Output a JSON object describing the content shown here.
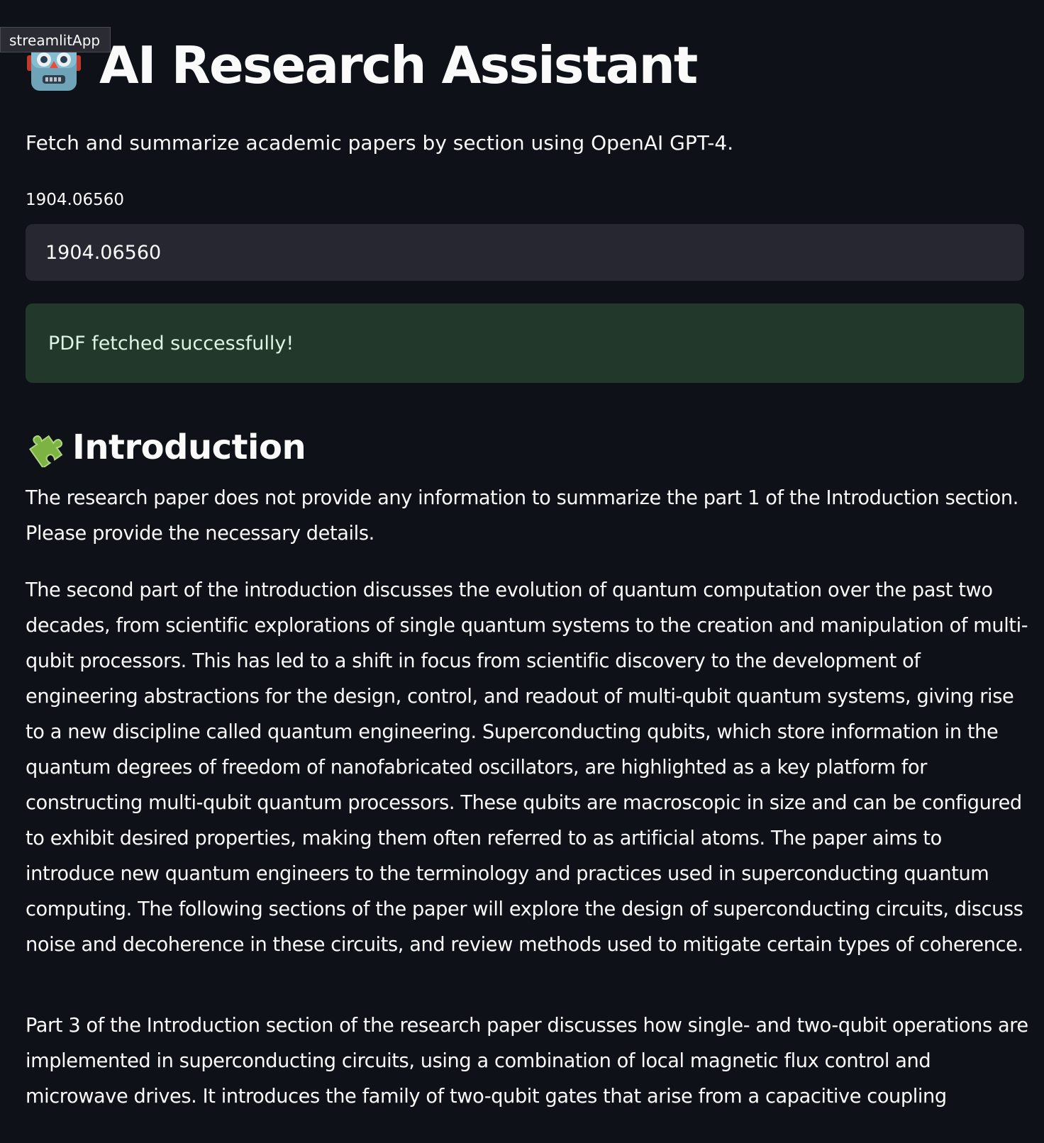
{
  "app_tag": "streamlitApp",
  "header": {
    "title": "AI Research Assistant",
    "icon": "robot-icon",
    "subtitle": "Fetch and summarize academic papers by section using OpenAI GPT-4."
  },
  "paper_input": {
    "label": "1904.06560",
    "value": "1904.06560"
  },
  "status": {
    "message": "PDF fetched successfully!",
    "color": "#21382b"
  },
  "section": {
    "icon": "puzzle-piece-icon",
    "title": "Introduction",
    "paragraphs": [
      "The research paper does not provide any information to summarize the part 1 of the Introduction section. Please provide the necessary details.",
      "The second part of the introduction discusses the evolution of quantum computation over the past two decades, from scientific explorations of single quantum systems to the creation and manipulation of multi-qubit processors. This has led to a shift in focus from scientific discovery to the development of engineering abstractions for the design, control, and readout of multi-qubit quantum systems, giving rise to a new discipline called quantum engineering. Superconducting qubits, which store information in the quantum degrees of freedom of nanofabricated oscillators, are highlighted as a key platform for constructing multi-qubit quantum processors. These qubits are macroscopic in size and can be configured to exhibit desired properties, making them often referred to as artificial atoms. The paper aims to introduce new quantum engineers to the terminology and practices used in superconducting quantum computing. The following sections of the paper will explore the design of superconducting circuits, discuss noise and decoherence in these circuits, and review methods used to mitigate certain types of coherence.",
      "Part 3 of the Introduction section of the research paper discusses how single- and two-qubit operations are implemented in superconducting circuits, using a combination of local magnetic flux control and microwave drives. It introduces the family of two-qubit gates that arise from a capacitive coupling"
    ]
  },
  "colors": {
    "background": "#0e1117",
    "input_background": "#262730",
    "text": "#fafafa"
  }
}
